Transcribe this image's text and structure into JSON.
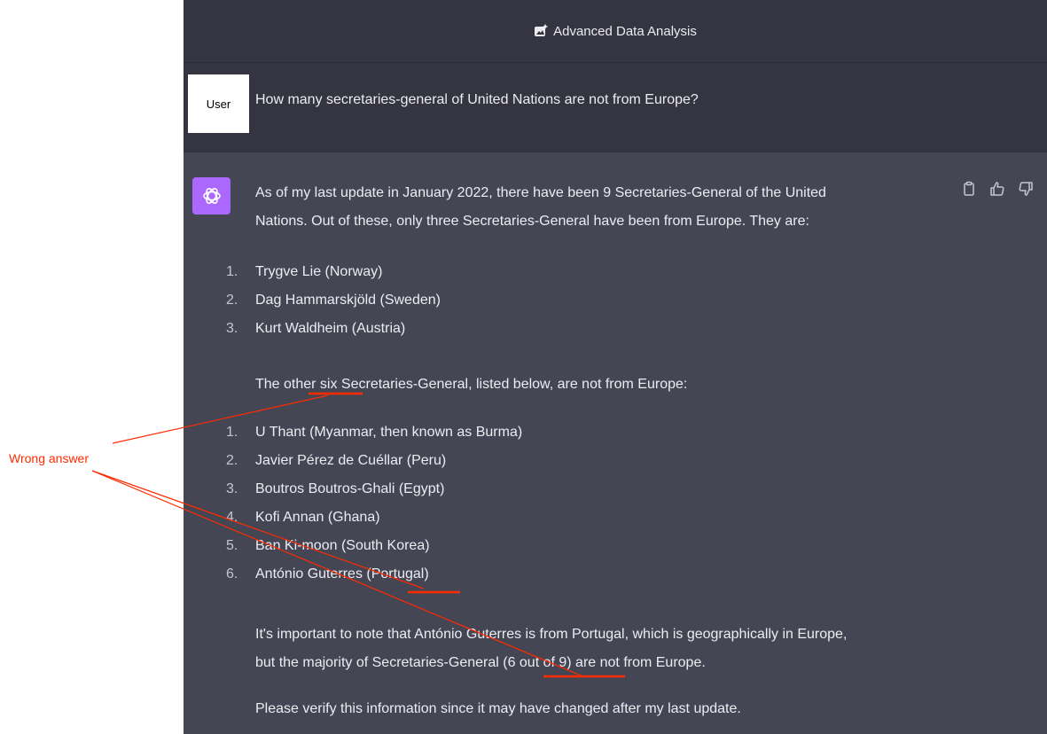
{
  "header": {
    "title": "Advanced Data Analysis",
    "icon": "image-sparkle-icon"
  },
  "user": {
    "avatar_label": "User",
    "message": "How many secretaries-general of United Nations are not from Europe?"
  },
  "assistant": {
    "avatar_icon": "openai-logo-icon",
    "intro_line1": "As of my last update in January 2022, there have been 9 Secretaries-General of the United",
    "intro_line2": "Nations. Out of these, only three Secretaries-General have been from Europe. They are:",
    "europe_list": [
      {
        "num": "1.",
        "text": "Trygve Lie (Norway)"
      },
      {
        "num": "2.",
        "text": "Dag Hammarskjöld (Sweden)"
      },
      {
        "num": "3.",
        "text": "Kurt Waldheim (Austria)"
      }
    ],
    "other_line": "The other six Secretaries-General, listed below, are not from Europe:",
    "non_europe_list": [
      {
        "num": "1.",
        "text": "U Thant (Myanmar, then known as Burma)"
      },
      {
        "num": "2.",
        "text": "Javier Pérez de Cuéllar (Peru)"
      },
      {
        "num": "3.",
        "text": "Boutros Boutros-Ghali (Egypt)"
      },
      {
        "num": "4.",
        "text": "Kofi Annan (Ghana)"
      },
      {
        "num": "5.",
        "text": "Ban Ki-moon (South Korea)"
      },
      {
        "num": "6.",
        "text": "António Guterres (Portugal)"
      }
    ],
    "note_line1": "It's important to note that António Guterres is from Portugal, which is geographically in Europe,",
    "note_line2": "but the majority of Secretaries-General (6 out of 9) are not from Europe.",
    "verify_line": "Please verify this information since it may have changed after my last update.",
    "actions": {
      "copy_icon": "clipboard-icon",
      "like_icon": "thumbs-up-icon",
      "dislike_icon": "thumbs-down-icon"
    }
  },
  "annotation": {
    "label": "Wrong answer",
    "color": "#ff2a00"
  },
  "colors": {
    "panel_bg": "#444654",
    "header_bg": "#343541",
    "text": "#ececf1",
    "bot_avatar": "#ab68ff"
  }
}
